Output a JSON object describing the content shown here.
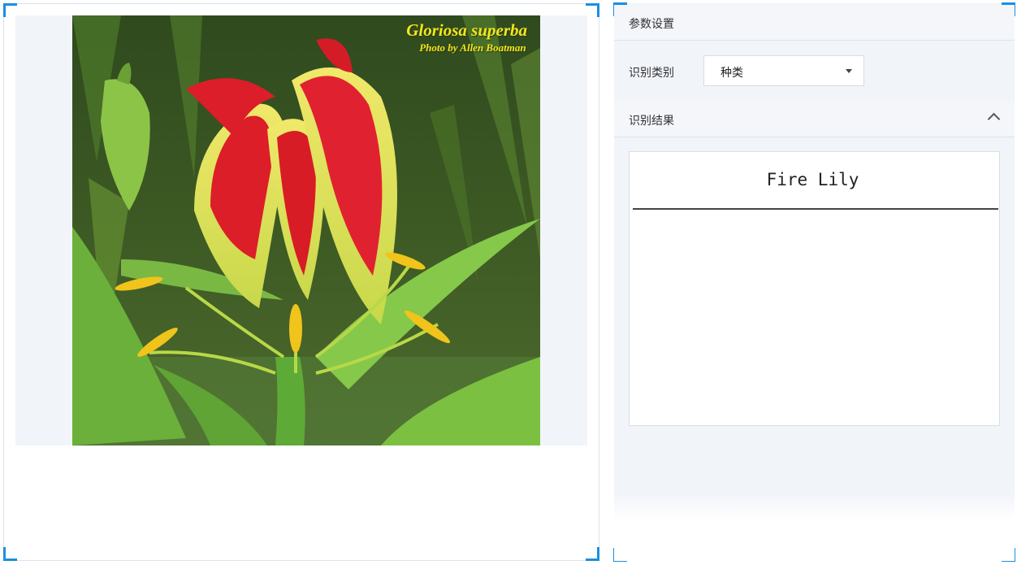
{
  "image_panel": {
    "caption_title": "Gloriosa superba",
    "caption_credit": "Photo by Allen Boatman",
    "subject": "red-and-yellow fire lily flower photo"
  },
  "settings": {
    "header": "参数设置",
    "category_label": "识别类别",
    "category_value": "种类"
  },
  "results": {
    "header": "识别结果",
    "result_name": "Fire Lily"
  },
  "colors": {
    "accent_corner": "#1a8fe0",
    "panel_bg": "#f1f4f9"
  }
}
